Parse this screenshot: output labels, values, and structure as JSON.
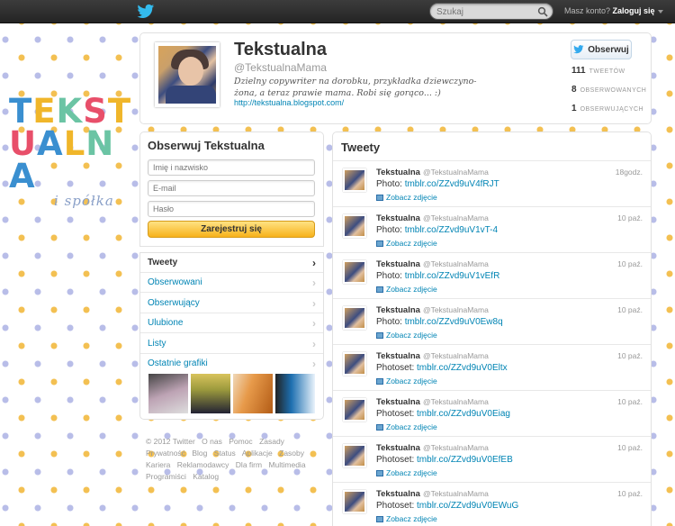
{
  "topbar": {
    "search_placeholder": "Szukaj",
    "account_prompt": "Masz konto?",
    "login_label": "Zaloguj się"
  },
  "logo": {
    "row1": [
      "T",
      "E",
      "K",
      "S",
      "T"
    ],
    "row2": [
      "U",
      "A",
      "L",
      "N",
      "A"
    ],
    "row1_colors": [
      "#3a8fd0",
      "#f0b62a",
      "#6bc4a4",
      "#e84f6a",
      "#f0b62a"
    ],
    "row2_colors": [
      "#e84f6a",
      "#3a8fd0",
      "#f0b62a",
      "#6bc4a4",
      "#3a8fd0"
    ],
    "sub": "i spółka"
  },
  "profile": {
    "name": "Tekstualna",
    "handle": "@TekstualnaMama",
    "bio": "Dzielny copywriter na dorobku, przykładka dziewczyno-żona, a teraz prawie mama. Robi się gorąco... :)",
    "url": "http://tekstualna.blogspot.com/",
    "follow_label": "Obserwuj",
    "stats": [
      {
        "value": "111",
        "label": "TWEETÓW"
      },
      {
        "value": "8",
        "label": "OBSERWOWANYCH"
      },
      {
        "value": "1",
        "label": "OBSERWUJĄCYCH"
      }
    ]
  },
  "signup": {
    "title": "Obserwuj Tekstualna",
    "name_placeholder": "Imię i nazwisko",
    "email_placeholder": "E-mail",
    "password_placeholder": "Hasło",
    "button": "Zarejestruj się"
  },
  "nav": {
    "items": [
      {
        "label": "Tweety"
      },
      {
        "label": "Obserwowani"
      },
      {
        "label": "Obserwujący"
      },
      {
        "label": "Ulubione"
      },
      {
        "label": "Listy"
      },
      {
        "label": "Ostatnie grafiki"
      }
    ]
  },
  "footer": {
    "links": [
      "© 2012 Twitter",
      "O nas",
      "Pomoc",
      "Zasady",
      "Prywatność",
      "Blog",
      "Status",
      "Aplikacje",
      "Zasoby",
      "Kariera",
      "Reklamodawcy",
      "Dla firm",
      "Multimedia",
      "Programiści",
      "Katalog"
    ]
  },
  "tweets": {
    "title": "Tweety",
    "items": [
      {
        "name": "Tekstualna",
        "handle": "@TekstualnaMama",
        "time": "18godz.",
        "prefix": "Photo: ",
        "link": "tmblr.co/ZZvd9uV4fRJT",
        "media": "Zobacz zdjęcie"
      },
      {
        "name": "Tekstualna",
        "handle": "@TekstualnaMama",
        "time": "10 paź.",
        "prefix": "Photo: ",
        "link": "tmblr.co/ZZvd9uV1vT-4",
        "media": "Zobacz zdjęcie"
      },
      {
        "name": "Tekstualna",
        "handle": "@TekstualnaMama",
        "time": "10 paź.",
        "prefix": "Photo: ",
        "link": "tmblr.co/ZZvd9uV1vEfR",
        "media": "Zobacz zdjęcie"
      },
      {
        "name": "Tekstualna",
        "handle": "@TekstualnaMama",
        "time": "10 paź.",
        "prefix": "Photo: ",
        "link": "tmblr.co/ZZvd9uV0Ew8q",
        "media": "Zobacz zdjęcie"
      },
      {
        "name": "Tekstualna",
        "handle": "@TekstualnaMama",
        "time": "10 paź.",
        "prefix": "Photoset: ",
        "link": "tmblr.co/ZZvd9uV0Eltx",
        "media": "Zobacz zdjęcie"
      },
      {
        "name": "Tekstualna",
        "handle": "@TekstualnaMama",
        "time": "10 paź.",
        "prefix": "Photoset: ",
        "link": "tmblr.co/ZZvd9uV0Eiag",
        "media": "Zobacz zdjęcie"
      },
      {
        "name": "Tekstualna",
        "handle": "@TekstualnaMama",
        "time": "10 paź.",
        "prefix": "Photoset: ",
        "link": "tmblr.co/ZZvd9uV0EfEB",
        "media": "Zobacz zdjęcie"
      },
      {
        "name": "Tekstualna",
        "handle": "@TekstualnaMama",
        "time": "10 paź.",
        "prefix": "Photoset: ",
        "link": "tmblr.co/ZZvd9uV0EWuG",
        "media": "Zobacz zdjęcie"
      }
    ]
  }
}
